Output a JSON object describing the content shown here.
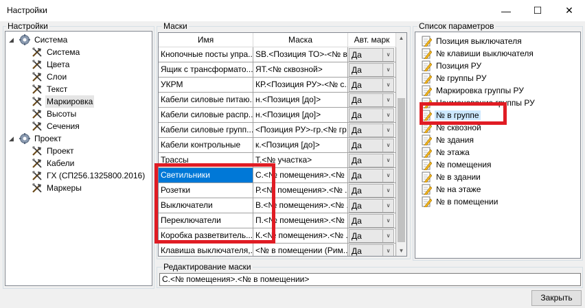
{
  "window": {
    "title": "Настройки"
  },
  "settings_panel": {
    "label": "Настройки",
    "tree": [
      {
        "label": "Система",
        "level": 0,
        "icon": "gear-icon",
        "expanded": true
      },
      {
        "label": "Система",
        "level": 1,
        "icon": "tools-icon"
      },
      {
        "label": "Цвета",
        "level": 1,
        "icon": "tools-icon"
      },
      {
        "label": "Слои",
        "level": 1,
        "icon": "tools-icon"
      },
      {
        "label": "Текст",
        "level": 1,
        "icon": "tools-icon"
      },
      {
        "label": "Маркировка",
        "level": 1,
        "icon": "tools-icon",
        "selected": true
      },
      {
        "label": "Высоты",
        "level": 1,
        "icon": "tools-icon"
      },
      {
        "label": "Сечения",
        "level": 1,
        "icon": "tools-icon"
      },
      {
        "label": "Проект",
        "level": 0,
        "icon": "gear-icon",
        "expanded": true
      },
      {
        "label": "Проект",
        "level": 1,
        "icon": "tools-icon"
      },
      {
        "label": "Кабели",
        "level": 1,
        "icon": "tools-icon"
      },
      {
        "label": "ГХ (СП256.1325800.2016)",
        "level": 1,
        "icon": "tools-icon"
      },
      {
        "label": "Маркеры",
        "level": 1,
        "icon": "tools-icon"
      }
    ]
  },
  "masks_panel": {
    "label": "Маски",
    "columns": [
      "Имя",
      "Маска",
      "Авт. марк"
    ],
    "rows": [
      {
        "name": "Кнопочные посты упра...",
        "mask": "SB.<Позиция ТО>-<№ в...",
        "auto": "Да"
      },
      {
        "name": "Ящик с трансформато...",
        "mask": "ЯТ.<№ сквозной>",
        "auto": "Да"
      },
      {
        "name": "УКРМ",
        "mask": "КР.<Позиция РУ>-<№ с...",
        "auto": "Да"
      },
      {
        "name": "Кабели силовые питаю...",
        "mask": "н.<Позиция [до]>",
        "auto": "Да"
      },
      {
        "name": "Кабели силовые распр...",
        "mask": "н.<Позиция [до]>",
        "auto": "Да"
      },
      {
        "name": "Кабели силовые групп...",
        "mask": "<Позиция РУ>-гр.<№ гр...",
        "auto": "Да"
      },
      {
        "name": "Кабели контрольные",
        "mask": "к.<Позиция [до]>",
        "auto": "Да"
      },
      {
        "name": "Трассы",
        "mask": "Т.<№ участка>",
        "auto": "Да"
      },
      {
        "name": "Светильники",
        "mask": "С.<№ помещения>.<№ ...",
        "auto": "Да",
        "selected": true
      },
      {
        "name": "Розетки",
        "mask": "Р.<№ помещения>.<№ ...",
        "auto": "Да"
      },
      {
        "name": "Выключатели",
        "mask": "В.<№ помещения>.<№ ...",
        "auto": "Да"
      },
      {
        "name": "Переключатели",
        "mask": "П.<№ помещения>.<№ ...",
        "auto": "Да"
      },
      {
        "name": "Коробка разветвитель...",
        "mask": "К.<№ помещения>.<№ ...",
        "auto": "Да"
      },
      {
        "name": "Клавиша выключателя,...",
        "mask": "<№ в помещении (Рим...",
        "auto": "Да"
      }
    ]
  },
  "params_panel": {
    "label": "Список параметров",
    "items": [
      "Позиция выключателя",
      "№ клавиши выключателя",
      "Позиция РУ",
      "№ группы РУ",
      "Маркировка группы РУ",
      "Наименование группы РУ",
      "№ в группе",
      "№ сквозной",
      "№ здания",
      "№ этажа",
      "№ помещения",
      "№ в здании",
      "№ на этаже",
      "№ в помещении"
    ],
    "selected_index": 6
  },
  "edit_mask": {
    "label": "Редактирование маски",
    "value": "С.<№ помещения>.<№ в помещении>"
  },
  "buttons": {
    "close": "Закрыть"
  },
  "colors": {
    "highlight_border": "#e01c24",
    "selection": "#0078d7"
  }
}
